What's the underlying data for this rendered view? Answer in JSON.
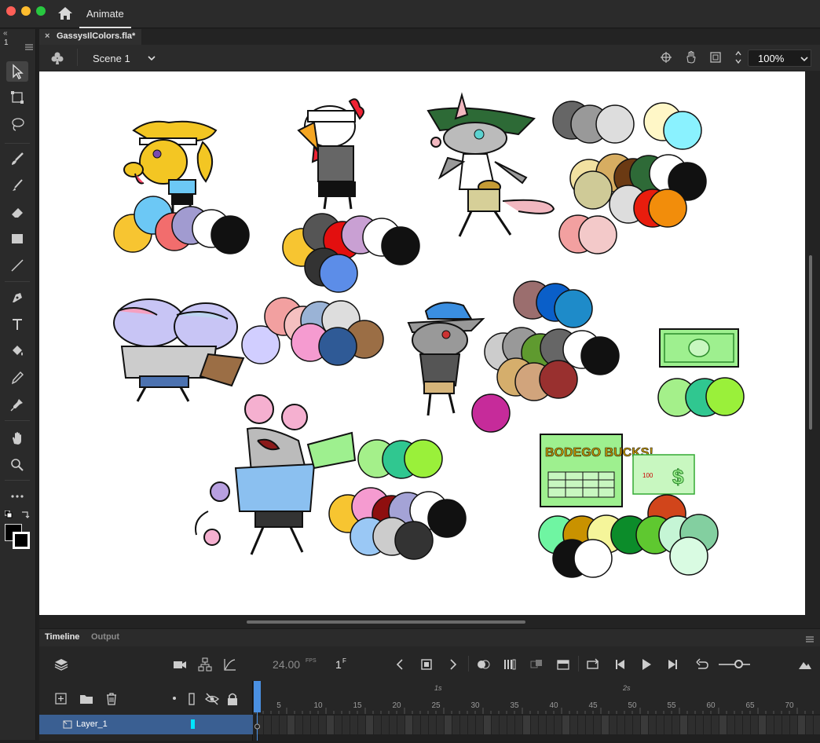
{
  "colors": {
    "accent": "#3a5f92",
    "playhead": "#4a90e2",
    "stage_bg": "#ffffff",
    "panel_bg": "#262626"
  },
  "titlebar": {
    "app_tab": "Animate",
    "home_icon": "home-icon"
  },
  "toolbar": {
    "collapse": "«",
    "panel_number": "1",
    "tools": [
      "selection-tool",
      "free-transform-tool",
      "lasso-tool",
      "brush-tool",
      "paint-brush-tool",
      "eraser-tool",
      "rectangle-tool",
      "line-tool",
      "pen-tool",
      "text-tool",
      "paint-bucket-tool",
      "eyedropper-tool",
      "asset-warp-tool",
      "hand-tool",
      "zoom-tool",
      "more-tools"
    ]
  },
  "document": {
    "tab_title": "GassysIlColors.fla*",
    "close": "×"
  },
  "scenebar": {
    "scene_label": "Scene 1",
    "zoom_value": "100%"
  },
  "timeline": {
    "tabs": [
      "Timeline",
      "Output"
    ],
    "fps_value": "24.00",
    "fps_unit": "FPS",
    "frame_value": "1",
    "frame_unit": "F",
    "second_labels": [
      "1s",
      "2s"
    ],
    "ruler_numbers": [
      "5",
      "10",
      "15",
      "20",
      "25",
      "30",
      "35",
      "40",
      "45",
      "50",
      "55",
      "60",
      "65",
      "70"
    ],
    "layer_name": "Layer_1"
  },
  "artwork": {
    "bill_label": "100",
    "ticket_text": "BODEGO BUCKS!",
    "ticket_badge": "$"
  }
}
